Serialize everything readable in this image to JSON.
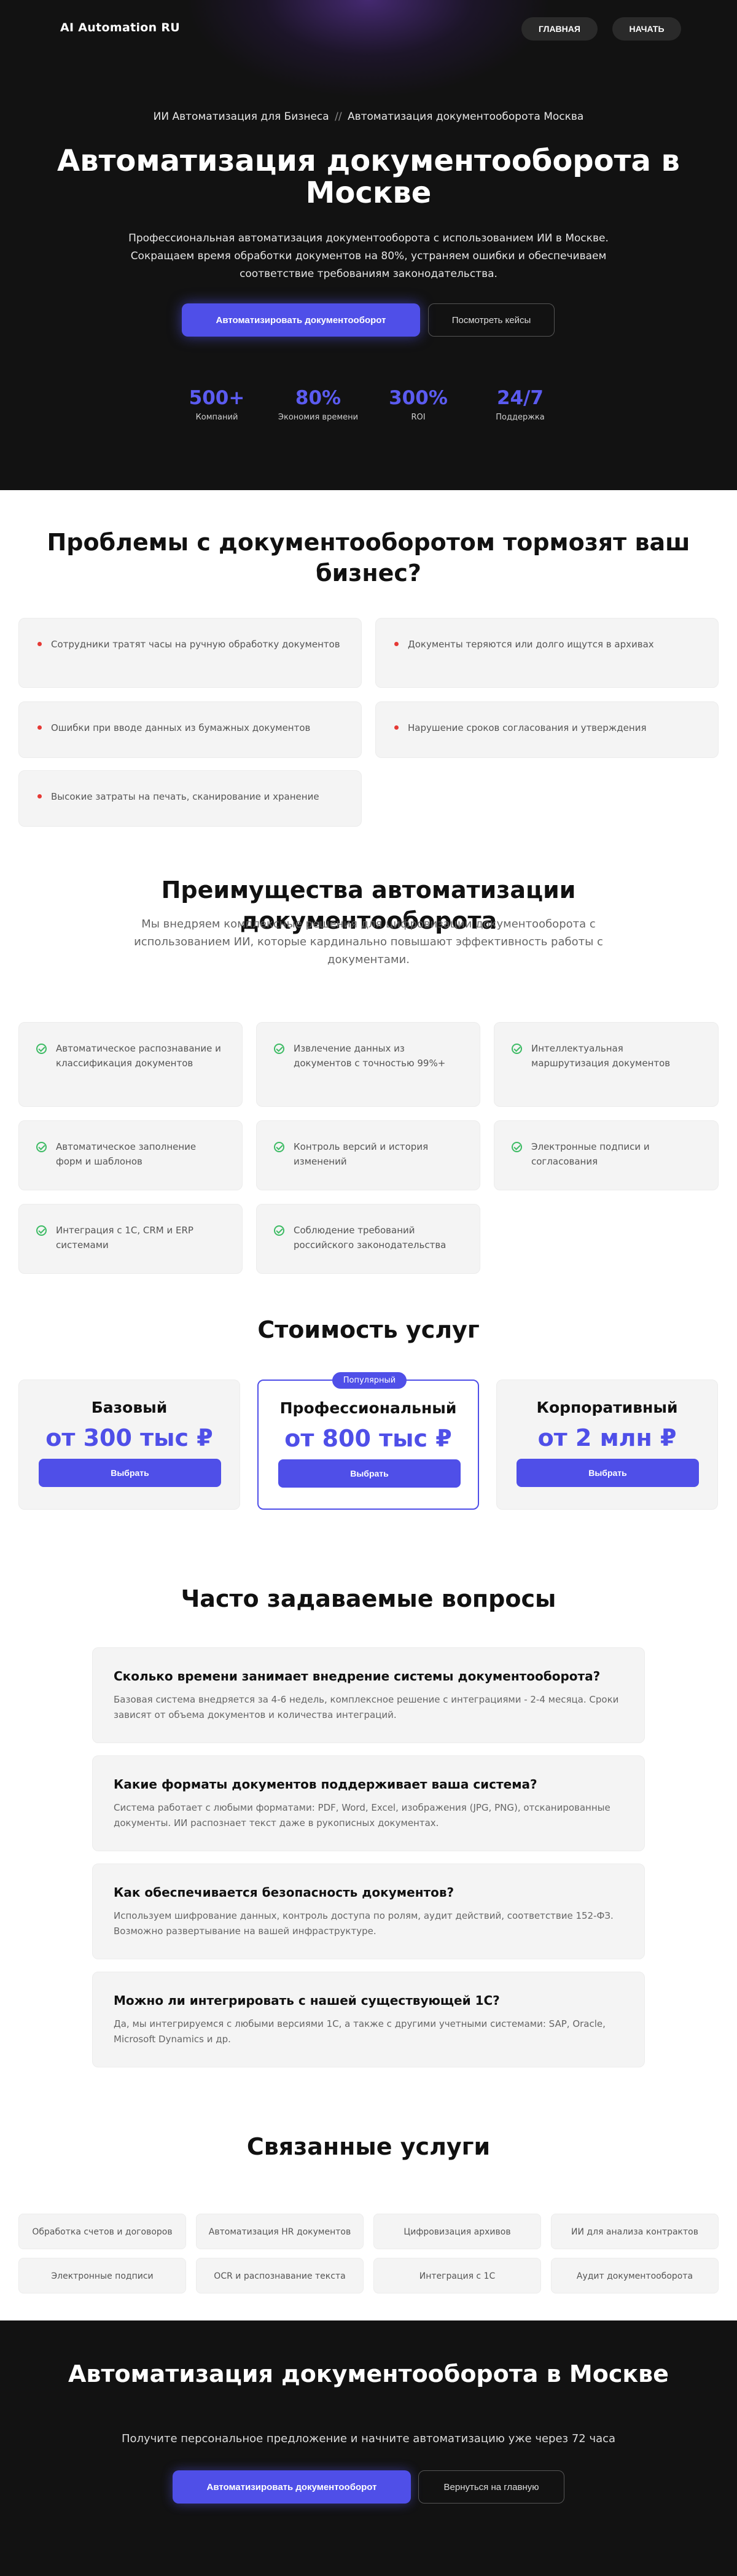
{
  "header": {
    "logo": "AI Automation RU",
    "nav": {
      "home": "ГЛАВНАЯ",
      "start": "НАЧАТЬ"
    }
  },
  "hero": {
    "breadcrumb_parent": "ИИ Автоматизация для Бизнеса",
    "breadcrumb_sep": "//",
    "breadcrumb_current": "Автоматизация документооборота Москва",
    "title": "Автоматизация документооборота в Москве",
    "subtitle": "Профессиональная автоматизация документооборота с использованием ИИ в Москве. Сокращаем время обработки документов на 80%, устраняем ошибки и обеспечиваем соответствие требованиям законодательства.",
    "primary_cta": "Автоматизировать документооборот",
    "secondary_cta": "Посмотреть кейсы",
    "stats": [
      {
        "value": "500+",
        "label": "Компаний"
      },
      {
        "value": "80%",
        "label": "Экономия времени"
      },
      {
        "value": "300%",
        "label": "ROI"
      },
      {
        "value": "24/7",
        "label": "Поддержка"
      }
    ]
  },
  "problems": {
    "title": "Проблемы с документооборотом тормозят ваш бизнес?",
    "items": [
      "Сотрудники тратят часы на ручную обработку документов",
      "Документы теряются или долго ищутся в архивах",
      "Ошибки при вводе данных из бумажных документов",
      "Нарушение сроков согласования и утверждения",
      "Высокие затраты на печать, сканирование и хранение"
    ]
  },
  "benefits": {
    "title": "Преимущества автоматизации документооборота",
    "subtitle": "Мы внедряем комплексные решения для цифровизации документооборота с использованием ИИ, которые кардинально повышают эффективность работы с документами.",
    "items": [
      "Автоматическое распознавание и классификация документов",
      "Извлечение данных из документов с точностью 99%+",
      "Интеллектуальная маршрутизация документов",
      "Автоматическое заполнение форм и шаблонов",
      "Контроль версий и история изменений",
      "Электронные подписи и согласования",
      "Интеграция с 1С, CRM и ERP системами",
      "Соблюдение требований российского законодательства"
    ]
  },
  "pricing": {
    "title": "Стоимость услуг",
    "popular_badge": "Популярный",
    "plans": [
      {
        "name": "Базовый",
        "price": "от 300 тыс ₽",
        "button": "Выбрать"
      },
      {
        "name": "Профессиональный",
        "price": "от 800 тыс ₽",
        "button": "Выбрать"
      },
      {
        "name": "Корпоративный",
        "price": "от 2 млн ₽",
        "button": "Выбрать"
      }
    ]
  },
  "faq": {
    "title": "Часто задаваемые вопросы",
    "items": [
      {
        "q": "Сколько времени занимает внедрение системы документооборота?",
        "a": "Базовая система внедряется за 4-6 недель, комплексное решение с интеграциями - 2-4 месяца. Сроки зависят от объема документов и количества интеграций."
      },
      {
        "q": "Какие форматы документов поддерживает ваша система?",
        "a": "Система работает с любыми форматами: PDF, Word, Excel, изображения (JPG, PNG), отсканированные документы. ИИ распознает текст даже в рукописных документах."
      },
      {
        "q": "Как обеспечивается безопасность документов?",
        "a": "Используем шифрование данных, контроль доступа по ролям, аудит действий, соответствие 152-ФЗ. Возможно развертывание на вашей инфраструктуре."
      },
      {
        "q": "Можно ли интегрировать с нашей существующей 1С?",
        "a": "Да, мы интегрируемся с любыми версиями 1С, а также с другими учетными системами: SAP, Oracle, Microsoft Dynamics и др."
      }
    ]
  },
  "related": {
    "title": "Связанные услуги",
    "items": [
      "Обработка счетов и договоров",
      "Автоматизация HR документов",
      "Цифровизация архивов",
      "ИИ для анализа контрактов",
      "Электронные подписи",
      "OCR и распознавание текста",
      "Интеграция с 1С",
      "Аудит документооборота"
    ]
  },
  "footer_cta": {
    "title": "Автоматизация документооборота в Москве",
    "subtitle": "Получите персональное предложение и начните автоматизацию уже через 72 часа",
    "primary": "Автоматизировать документооборот",
    "secondary": "Вернуться на главную"
  },
  "colors": {
    "accent": "#4f4fe8",
    "dark_bg": "#121212",
    "problem_dot": "#e53935",
    "check": "#3dbb64"
  }
}
